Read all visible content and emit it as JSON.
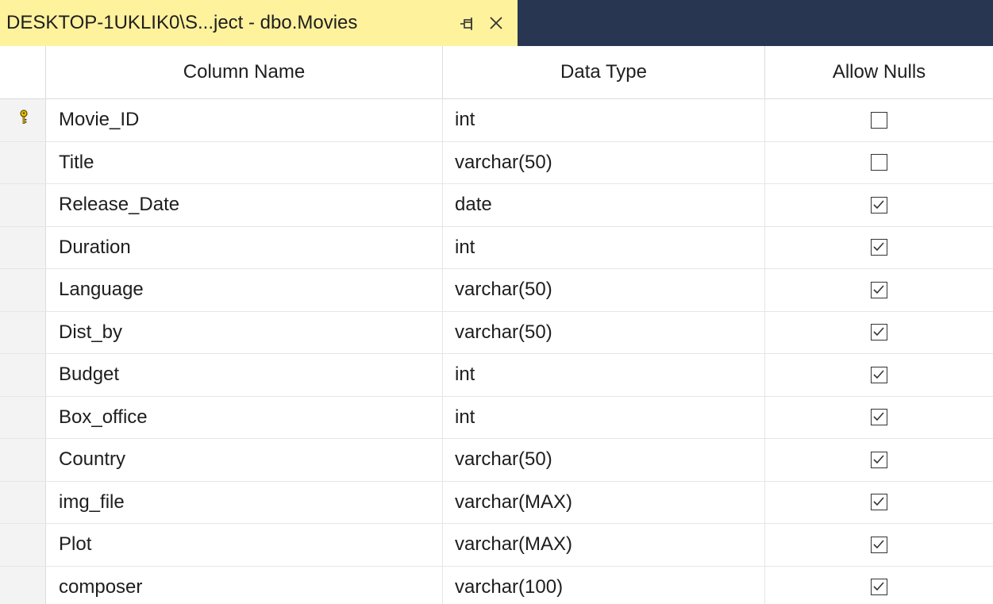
{
  "tab": {
    "title": "DESKTOP-1UKLIK0\\S...ject - dbo.Movies",
    "pin_icon": "pin-icon",
    "close_icon": "close-icon"
  },
  "columns": {
    "name_header": "Column Name",
    "type_header": "Data Type",
    "nulls_header": "Allow Nulls"
  },
  "rows": [
    {
      "name": "Movie_ID",
      "type": "int",
      "allow_nulls": false,
      "primary_key": true
    },
    {
      "name": "Title",
      "type": "varchar(50)",
      "allow_nulls": false,
      "primary_key": false
    },
    {
      "name": "Release_Date",
      "type": "date",
      "allow_nulls": true,
      "primary_key": false
    },
    {
      "name": "Duration",
      "type": "int",
      "allow_nulls": true,
      "primary_key": false
    },
    {
      "name": "Language",
      "type": "varchar(50)",
      "allow_nulls": true,
      "primary_key": false
    },
    {
      "name": "Dist_by",
      "type": "varchar(50)",
      "allow_nulls": true,
      "primary_key": false
    },
    {
      "name": "Budget",
      "type": "int",
      "allow_nulls": true,
      "primary_key": false
    },
    {
      "name": "Box_office",
      "type": "int",
      "allow_nulls": true,
      "primary_key": false
    },
    {
      "name": "Country",
      "type": "varchar(50)",
      "allow_nulls": true,
      "primary_key": false
    },
    {
      "name": "img_file",
      "type": "varchar(MAX)",
      "allow_nulls": true,
      "primary_key": false
    },
    {
      "name": "Plot",
      "type": "varchar(MAX)",
      "allow_nulls": true,
      "primary_key": false
    },
    {
      "name": "composer",
      "type": "varchar(100)",
      "allow_nulls": true,
      "primary_key": false
    }
  ],
  "colors": {
    "tab_active": "#fff29d",
    "tab_strip": "#283652"
  }
}
